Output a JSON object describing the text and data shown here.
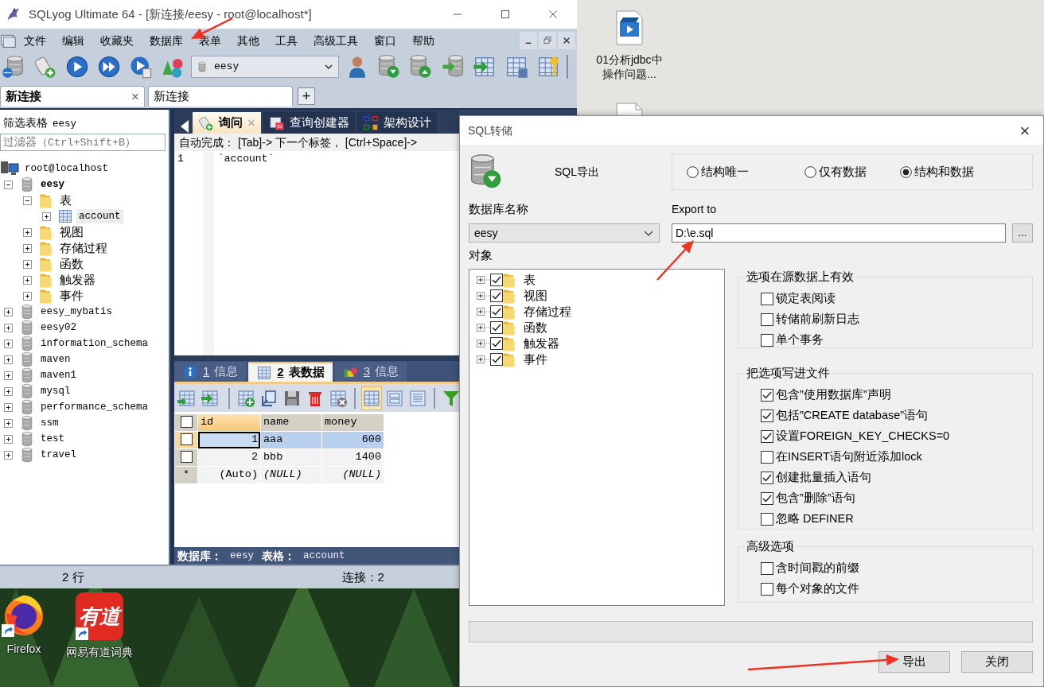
{
  "desktop": {
    "icons": [
      {
        "kind": "video",
        "label": "01分析jdbc中操作问题..."
      },
      {
        "kind": "document"
      },
      {
        "kind": "firefox",
        "label": "Firefox",
        "shortcut": true
      },
      {
        "kind": "youdao",
        "label": "网易有道词典",
        "logo_text": "有道",
        "shortcut": true
      }
    ]
  },
  "app": {
    "title": "SQLyog Ultimate 64 - [新连接/eesy - root@localhost*]",
    "menu": [
      "文件",
      "编辑",
      "收藏夹",
      "数据库",
      "表单",
      "其他",
      "工具",
      "高级工具",
      "窗口",
      "帮助"
    ],
    "toolbar_database": "eesy",
    "connection_tabs": [
      {
        "label": "新连接",
        "selected": true,
        "close": "×"
      },
      {
        "label": "新连接",
        "selected": false
      }
    ],
    "add_tab": "+",
    "filter": {
      "label": "筛选表格",
      "database": "eesy",
      "placeholder": "过滤器（Ctrl+Shift+B）"
    },
    "tree": [
      {
        "kind": "server",
        "label": "root@localhost",
        "selected": false,
        "children": [
          {
            "kind": "database",
            "label": "eesy",
            "current": true,
            "expanded": true,
            "selected": false,
            "children": [
              {
                "kind": "folder",
                "label": "表",
                "expanded": true,
                "selected": false,
                "children": [
                  {
                    "kind": "table",
                    "label": "account",
                    "expanded": false,
                    "selected": true
                  }
                ]
              },
              {
                "kind": "folder",
                "label": "视图",
                "expanded": false,
                "selected": false
              },
              {
                "kind": "folder",
                "label": "存储过程",
                "expanded": false,
                "selected": false
              },
              {
                "kind": "folder",
                "label": "函数",
                "expanded": false,
                "selected": false
              },
              {
                "kind": "folder",
                "label": "触发器",
                "expanded": false,
                "selected": false
              },
              {
                "kind": "folder",
                "label": "事件",
                "expanded": false,
                "selected": false
              }
            ]
          },
          {
            "kind": "database",
            "label": "eesy_mybatis",
            "current": false,
            "expanded": false,
            "selected": false
          },
          {
            "kind": "database",
            "label": "eesy02",
            "current": false,
            "expanded": false,
            "selected": false
          },
          {
            "kind": "database",
            "label": "information_schema",
            "current": false,
            "expanded": false,
            "selected": false
          },
          {
            "kind": "database",
            "label": "maven",
            "current": false,
            "expanded": false,
            "selected": false
          },
          {
            "kind": "database",
            "label": "maven1",
            "current": false,
            "expanded": false,
            "selected": false
          },
          {
            "kind": "database",
            "label": "mysql",
            "current": false,
            "expanded": false,
            "selected": false
          },
          {
            "kind": "database",
            "label": "performance_schema",
            "current": false,
            "expanded": false,
            "selected": false
          },
          {
            "kind": "database",
            "label": "ssm",
            "current": false,
            "expanded": false,
            "selected": false
          },
          {
            "kind": "database",
            "label": "test",
            "current": false,
            "expanded": false,
            "selected": false
          },
          {
            "kind": "database",
            "label": "travel",
            "current": false,
            "expanded": false,
            "selected": false
          }
        ]
      }
    ],
    "query_tabs": [
      {
        "kind": "query",
        "label": "询问",
        "selected": true,
        "close": "×"
      },
      {
        "kind": "builder",
        "label": "查询创建器",
        "selected": false
      },
      {
        "kind": "schema",
        "label": "架构设计",
        "selected": false
      }
    ],
    "autocomplete": "自动完成： [Tab]-> 下一个标签， [Ctrl+Space]->",
    "editor": [
      {
        "number": "1",
        "text": "`account`"
      }
    ],
    "result_tabs": [
      {
        "kind": "info",
        "number": "1",
        "label": "信息",
        "selected": false
      },
      {
        "kind": "table",
        "number": "2",
        "label": "表数据",
        "selected": true
      },
      {
        "kind": "messages",
        "number": "3",
        "label": "信息",
        "selected": false
      }
    ],
    "grid": {
      "all_checked": false,
      "columns": [
        {
          "label": "id",
          "selected": true
        },
        {
          "label": "name",
          "selected": false
        },
        {
          "label": "money",
          "selected": false
        }
      ],
      "rows": [
        {
          "selected": true,
          "checked": false,
          "cells": [
            "1",
            "aaa",
            "600"
          ]
        },
        {
          "selected": false,
          "checked": false,
          "cells": [
            "2",
            "bbb",
            "1400"
          ]
        }
      ],
      "new_row": {
        "marker": "*",
        "cells": [
          "(Auto)",
          "(NULL)",
          "(NULL)"
        ]
      }
    },
    "footer": {
      "database_label": "数据库：",
      "database": "eesy",
      "table_label": "表格：",
      "table": "account"
    },
    "status": {
      "rows": "2 行",
      "connections": "连接：2"
    }
  },
  "dialog": {
    "title": "SQL转储",
    "close": "×",
    "heading": "SQL导出",
    "modes": [
      {
        "label": "结构唯一",
        "selected": false
      },
      {
        "label": "仅有数据",
        "selected": false
      },
      {
        "label": "结构和数据",
        "selected": true
      }
    ],
    "database_label": "数据库名称",
    "database": "eesy",
    "export_label": "Export to",
    "export_path": "D:\\e.sql",
    "browse": "...",
    "objects_label": "对象",
    "objects": [
      {
        "label": "表",
        "checked": true
      },
      {
        "label": "视图",
        "checked": true
      },
      {
        "label": "存储过程",
        "checked": true
      },
      {
        "label": "函数",
        "checked": true
      },
      {
        "label": "触发器",
        "checked": true
      },
      {
        "label": "事件",
        "checked": true
      }
    ],
    "groups": [
      {
        "title": "选项在源数据上有效",
        "options": [
          {
            "label": "锁定表阅读",
            "checked": false
          },
          {
            "label": "转储前刷新日志",
            "checked": false
          },
          {
            "label": "单个事务",
            "checked": false
          }
        ]
      },
      {
        "title": "把选项写进文件",
        "options": [
          {
            "label": "包含”使用数据库”声明",
            "checked": true
          },
          {
            "label": "包括”CREATE database”语句",
            "checked": true
          },
          {
            "label": "设置FOREIGN_KEY_CHECKS=0",
            "checked": true
          },
          {
            "label": "在INSERT语句附近添加lock",
            "checked": false
          },
          {
            "label": "创建批量插入语句",
            "checked": true
          },
          {
            "label": "包含”删除”语句",
            "checked": true
          },
          {
            "label": "忽略 DEFINER",
            "checked": false
          }
        ]
      },
      {
        "title": "高级选项",
        "options": [
          {
            "label": "含时间戳的前缀",
            "checked": false
          },
          {
            "label": "每个对象的文件",
            "checked": false
          }
        ]
      }
    ],
    "progress": {
      "level": 0
    },
    "buttons": [
      "导出",
      "关闭"
    ]
  }
}
